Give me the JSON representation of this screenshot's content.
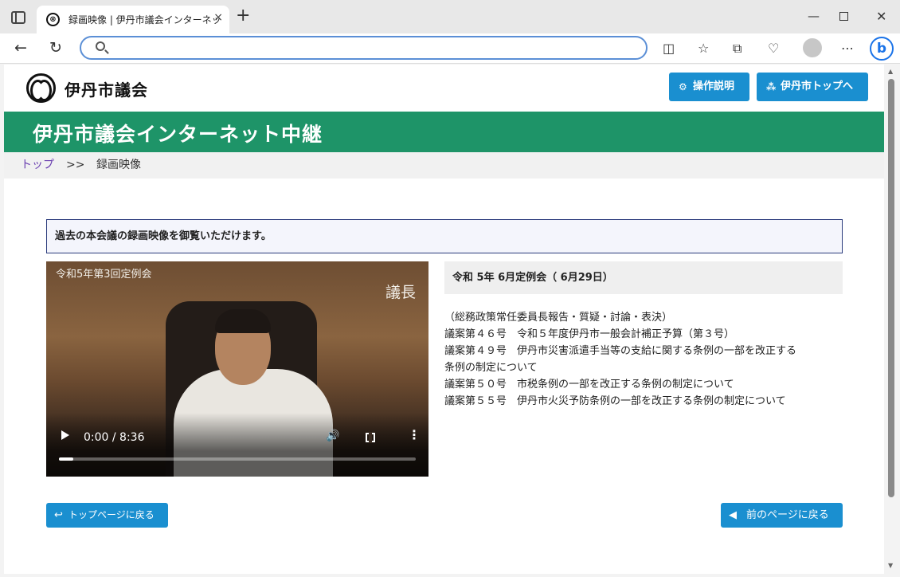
{
  "browser": {
    "tab_title": "録画映像 | 伊丹市議会インターネット中継",
    "tab_favicon": "⊗",
    "tab_close": "×",
    "new_tab": "+",
    "minimize": "—",
    "close": "✕",
    "back": "←",
    "reload": "↻",
    "address_value": "",
    "toolbar_icons": [
      "split-screen-icon",
      "favorites-star-icon",
      "collections-icon",
      "browser-essentials-icon",
      "more-icon"
    ],
    "bing": "b"
  },
  "header": {
    "site_name": "伊丹市議会",
    "help_button": "操作説明",
    "top_button": "伊丹市トップへ"
  },
  "banner": {
    "title": "伊丹市議会インターネット中継"
  },
  "breadcrumb": {
    "top": "トップ",
    "separator": ">>",
    "current": "録画映像"
  },
  "notice": "過去の本会議の録画映像を御覧いただけます。",
  "video": {
    "caption": "令和5年第3回定例会",
    "role": "議長",
    "time": "0:00 / 8:36",
    "progress": 0.04
  },
  "session": {
    "heading": "令和 5年 6月定例会（ 6月29日）",
    "lines": [
      "（総務政策常任委員長報告・質疑・討論・表決）",
      "議案第４６号　令和５年度伊丹市一般会計補正予算（第３号）",
      "議案第４９号　伊丹市災害派遣手当等の支給に関する条例の一部を改正する",
      "条例の制定について",
      "議案第５０号　市税条例の一部を改正する条例の制定について",
      "議案第５５号　伊丹市火災予防条例の一部を改正する条例の制定について"
    ]
  },
  "footer_buttons": {
    "top_page": "トップページに戻る",
    "prev_page": "前のページに戻る"
  },
  "colors": {
    "banner_green": "#1e9468",
    "button_blue": "#1a8fd0",
    "notice_border": "#2a3b7c"
  }
}
